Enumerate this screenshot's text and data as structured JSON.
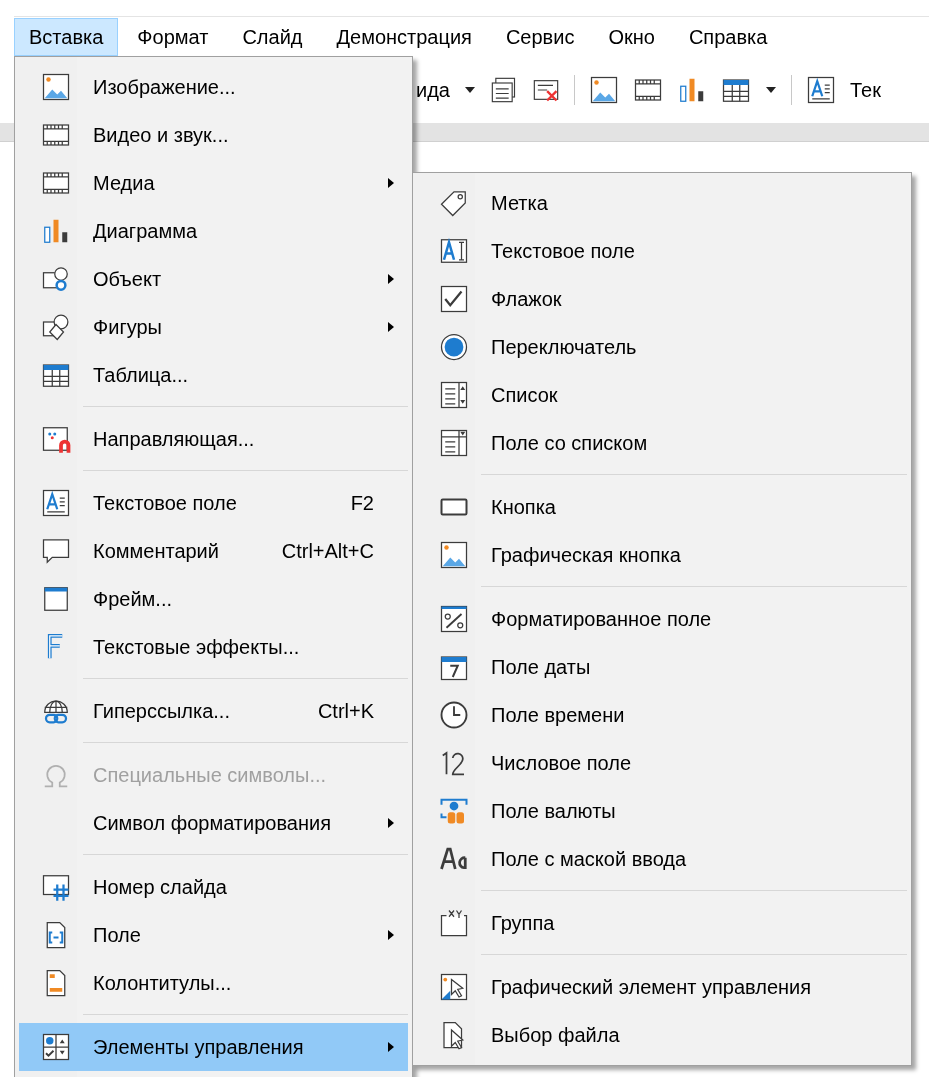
{
  "menubar": [
    {
      "label": "Вставка",
      "selected": true
    },
    {
      "label": "Формат",
      "selected": false
    },
    {
      "label": "Слайд",
      "selected": false
    },
    {
      "label": "Демонстрация",
      "selected": false
    },
    {
      "label": "Сервис",
      "selected": false
    },
    {
      "label": "Окно",
      "selected": false
    },
    {
      "label": "Справка",
      "selected": false
    }
  ],
  "toolbar": {
    "left_text": "ида",
    "right_text": "Тек"
  },
  "insert_menu": [
    {
      "kind": "item",
      "label": "Изображение...",
      "has_submenu": false,
      "disabled": false,
      "selected": false
    },
    {
      "kind": "item",
      "label": "Видео и звук...",
      "has_submenu": false,
      "disabled": false,
      "selected": false
    },
    {
      "kind": "item",
      "label": "Медиа",
      "has_submenu": true,
      "disabled": false,
      "selected": false
    },
    {
      "kind": "item",
      "label": "Диаграмма",
      "has_submenu": false,
      "disabled": false,
      "selected": false
    },
    {
      "kind": "item",
      "label": "Объект",
      "has_submenu": true,
      "disabled": false,
      "selected": false
    },
    {
      "kind": "item",
      "label": "Фигуры",
      "has_submenu": true,
      "disabled": false,
      "selected": false
    },
    {
      "kind": "item",
      "label": "Таблица...",
      "has_submenu": false,
      "disabled": false,
      "selected": false
    },
    {
      "kind": "separator"
    },
    {
      "kind": "item",
      "label": "Направляющая...",
      "has_submenu": false,
      "disabled": false,
      "selected": false
    },
    {
      "kind": "separator"
    },
    {
      "kind": "item",
      "label": "Текстовое поле",
      "shortcut": "F2",
      "has_submenu": false,
      "disabled": false,
      "selected": false
    },
    {
      "kind": "item",
      "label": "Комментарий",
      "shortcut": "Ctrl+Alt+C",
      "has_submenu": false,
      "disabled": false,
      "selected": false
    },
    {
      "kind": "item",
      "label": "Фрейм...",
      "has_submenu": false,
      "disabled": false,
      "selected": false
    },
    {
      "kind": "item",
      "label": "Текстовые эффекты...",
      "has_submenu": false,
      "disabled": false,
      "selected": false
    },
    {
      "kind": "separator"
    },
    {
      "kind": "item",
      "label": "Гиперссылка...",
      "shortcut": "Ctrl+K",
      "has_submenu": false,
      "disabled": false,
      "selected": false
    },
    {
      "kind": "separator"
    },
    {
      "kind": "item",
      "label": "Специальные символы...",
      "has_submenu": false,
      "disabled": true,
      "selected": false
    },
    {
      "kind": "item",
      "label": "Символ форматирования",
      "has_submenu": true,
      "disabled": false,
      "selected": false
    },
    {
      "kind": "separator"
    },
    {
      "kind": "item",
      "label": "Номер слайда",
      "has_submenu": false,
      "disabled": false,
      "selected": false
    },
    {
      "kind": "item",
      "label": "Поле",
      "has_submenu": true,
      "disabled": false,
      "selected": false
    },
    {
      "kind": "item",
      "label": "Колонтитулы...",
      "has_submenu": false,
      "disabled": false,
      "selected": false
    },
    {
      "kind": "separator"
    },
    {
      "kind": "item",
      "label": "Элементы управления",
      "has_submenu": true,
      "disabled": false,
      "selected": true
    }
  ],
  "controls_submenu": [
    {
      "kind": "item",
      "label": "Метка"
    },
    {
      "kind": "item",
      "label": "Текстовое поле"
    },
    {
      "kind": "item",
      "label": "Флажок"
    },
    {
      "kind": "item",
      "label": "Переключатель"
    },
    {
      "kind": "item",
      "label": "Список"
    },
    {
      "kind": "item",
      "label": "Поле со списком"
    },
    {
      "kind": "separator"
    },
    {
      "kind": "item",
      "label": "Кнопка"
    },
    {
      "kind": "item",
      "label": "Графическая кнопка"
    },
    {
      "kind": "separator"
    },
    {
      "kind": "item",
      "label": "Форматированное поле"
    },
    {
      "kind": "item",
      "label": "Поле даты"
    },
    {
      "kind": "item",
      "label": "Поле времени"
    },
    {
      "kind": "item",
      "label": "Числовое поле"
    },
    {
      "kind": "item",
      "label": "Поле валюты"
    },
    {
      "kind": "item",
      "label": "Поле с маской ввода"
    },
    {
      "kind": "separator"
    },
    {
      "kind": "item",
      "label": "Группа"
    },
    {
      "kind": "separator"
    },
    {
      "kind": "item",
      "label": "Графический элемент управления"
    },
    {
      "kind": "item",
      "label": "Выбор файла"
    }
  ]
}
